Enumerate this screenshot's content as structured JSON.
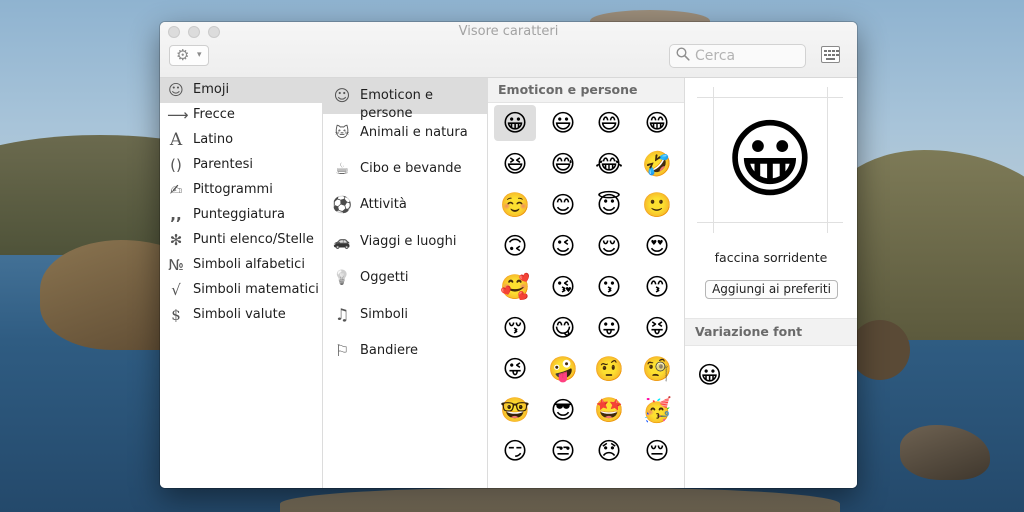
{
  "window": {
    "title": "Visore caratteri",
    "search_placeholder": "Cerca"
  },
  "categories": [
    {
      "icon": "☺",
      "label": "Emoji",
      "selected": true
    },
    {
      "icon": "⟶",
      "label": "Frecce"
    },
    {
      "icon": "A",
      "label": "Latino"
    },
    {
      "icon": "()",
      "label": "Parentesi"
    },
    {
      "icon": "✍",
      "label": "Pittogrammi"
    },
    {
      "icon": ",,",
      "label": "Punteggiatura"
    },
    {
      "icon": "✻",
      "label": "Punti elenco/Stelle"
    },
    {
      "icon": "№",
      "label": "Simboli alfabetici"
    },
    {
      "icon": "√",
      "label": "Simboli matematici"
    },
    {
      "icon": "$",
      "label": "Simboli valute"
    }
  ],
  "subcategories": [
    {
      "icon": "☺",
      "label": "Emoticon e persone",
      "selected": true
    },
    {
      "icon": "🐱",
      "label": "Animali e natura"
    },
    {
      "icon": "☕",
      "label": "Cibo e bevande"
    },
    {
      "icon": "⚽",
      "label": "Attività"
    },
    {
      "icon": "🚗",
      "label": "Viaggi e luoghi"
    },
    {
      "icon": "💡",
      "label": "Oggetti"
    },
    {
      "icon": "♫",
      "label": "Simboli"
    },
    {
      "icon": "⚐",
      "label": "Bandiere"
    }
  ],
  "grid": {
    "title": "Emoticon e persone",
    "emojis": [
      "😀",
      "😃",
      "😄",
      "😁",
      "😆",
      "😅",
      "😂",
      "🤣",
      "☺️",
      "😊",
      "😇",
      "🙂",
      "🙃",
      "😉",
      "😌",
      "😍",
      "🥰",
      "😘",
      "😗",
      "😙",
      "😚",
      "😋",
      "😛",
      "😝",
      "😜",
      "🤪",
      "🤨",
      "🧐",
      "🤓",
      "😎",
      "🤩",
      "🥳",
      "😏",
      "😒",
      "😞",
      "😔"
    ],
    "selected_index": 0
  },
  "detail": {
    "emoji": "😀",
    "name": "faccina sorridente",
    "favorite_button": "Aggiungi ai preferiti",
    "font_variation_title": "Variazione font",
    "font_variations": [
      "😀"
    ]
  }
}
